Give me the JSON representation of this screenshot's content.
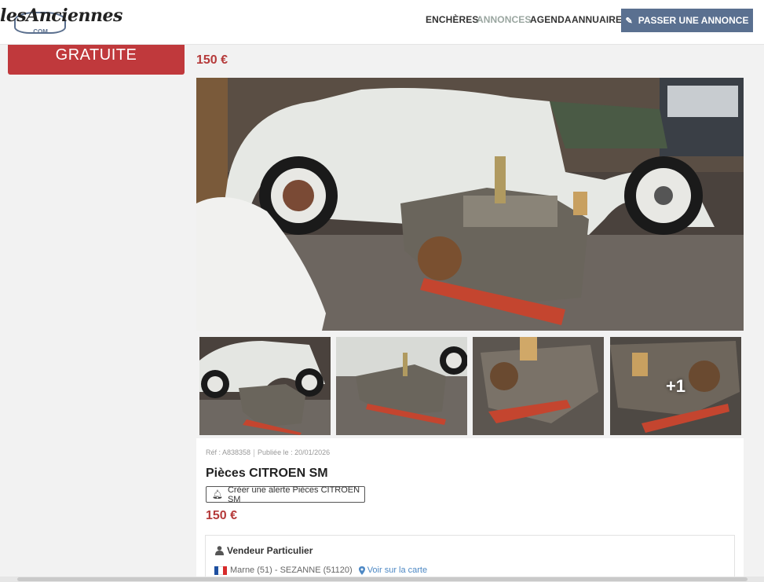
{
  "header": {
    "logo_text": "lesAnciennes",
    "logo_sub": ".COM",
    "nav": [
      {
        "label": "ENCHÈRES",
        "active": false
      },
      {
        "label": "ANNONCES",
        "active": true
      },
      {
        "label": "AGENDA",
        "active": false
      },
      {
        "label": "ANNUAIRE",
        "active": false
      }
    ],
    "post_button": "PASSER UNE ANNONCE"
  },
  "sidebar": {
    "free_button": "GRATUITE"
  },
  "listing": {
    "price_top": "150 €",
    "more_photos": "+1",
    "ref": "Réf : A838358",
    "published": "Publiée le : 20/01/2026",
    "title": "Pièces CITROEN SM",
    "alert_button": "Créer une alerte Pièces CITROEN SM",
    "price": "150 €",
    "seller_type": "Vendeur Particulier",
    "location": "Marne (51) - SEZANNE (51120)",
    "map_link": "Voir sur la carte"
  },
  "colors": {
    "accent_red": "#c0393c",
    "price_red": "#b53a3a",
    "button_blue": "#5a7090",
    "link_blue": "#4d88c4",
    "nav_active": "#9aa6a0"
  }
}
